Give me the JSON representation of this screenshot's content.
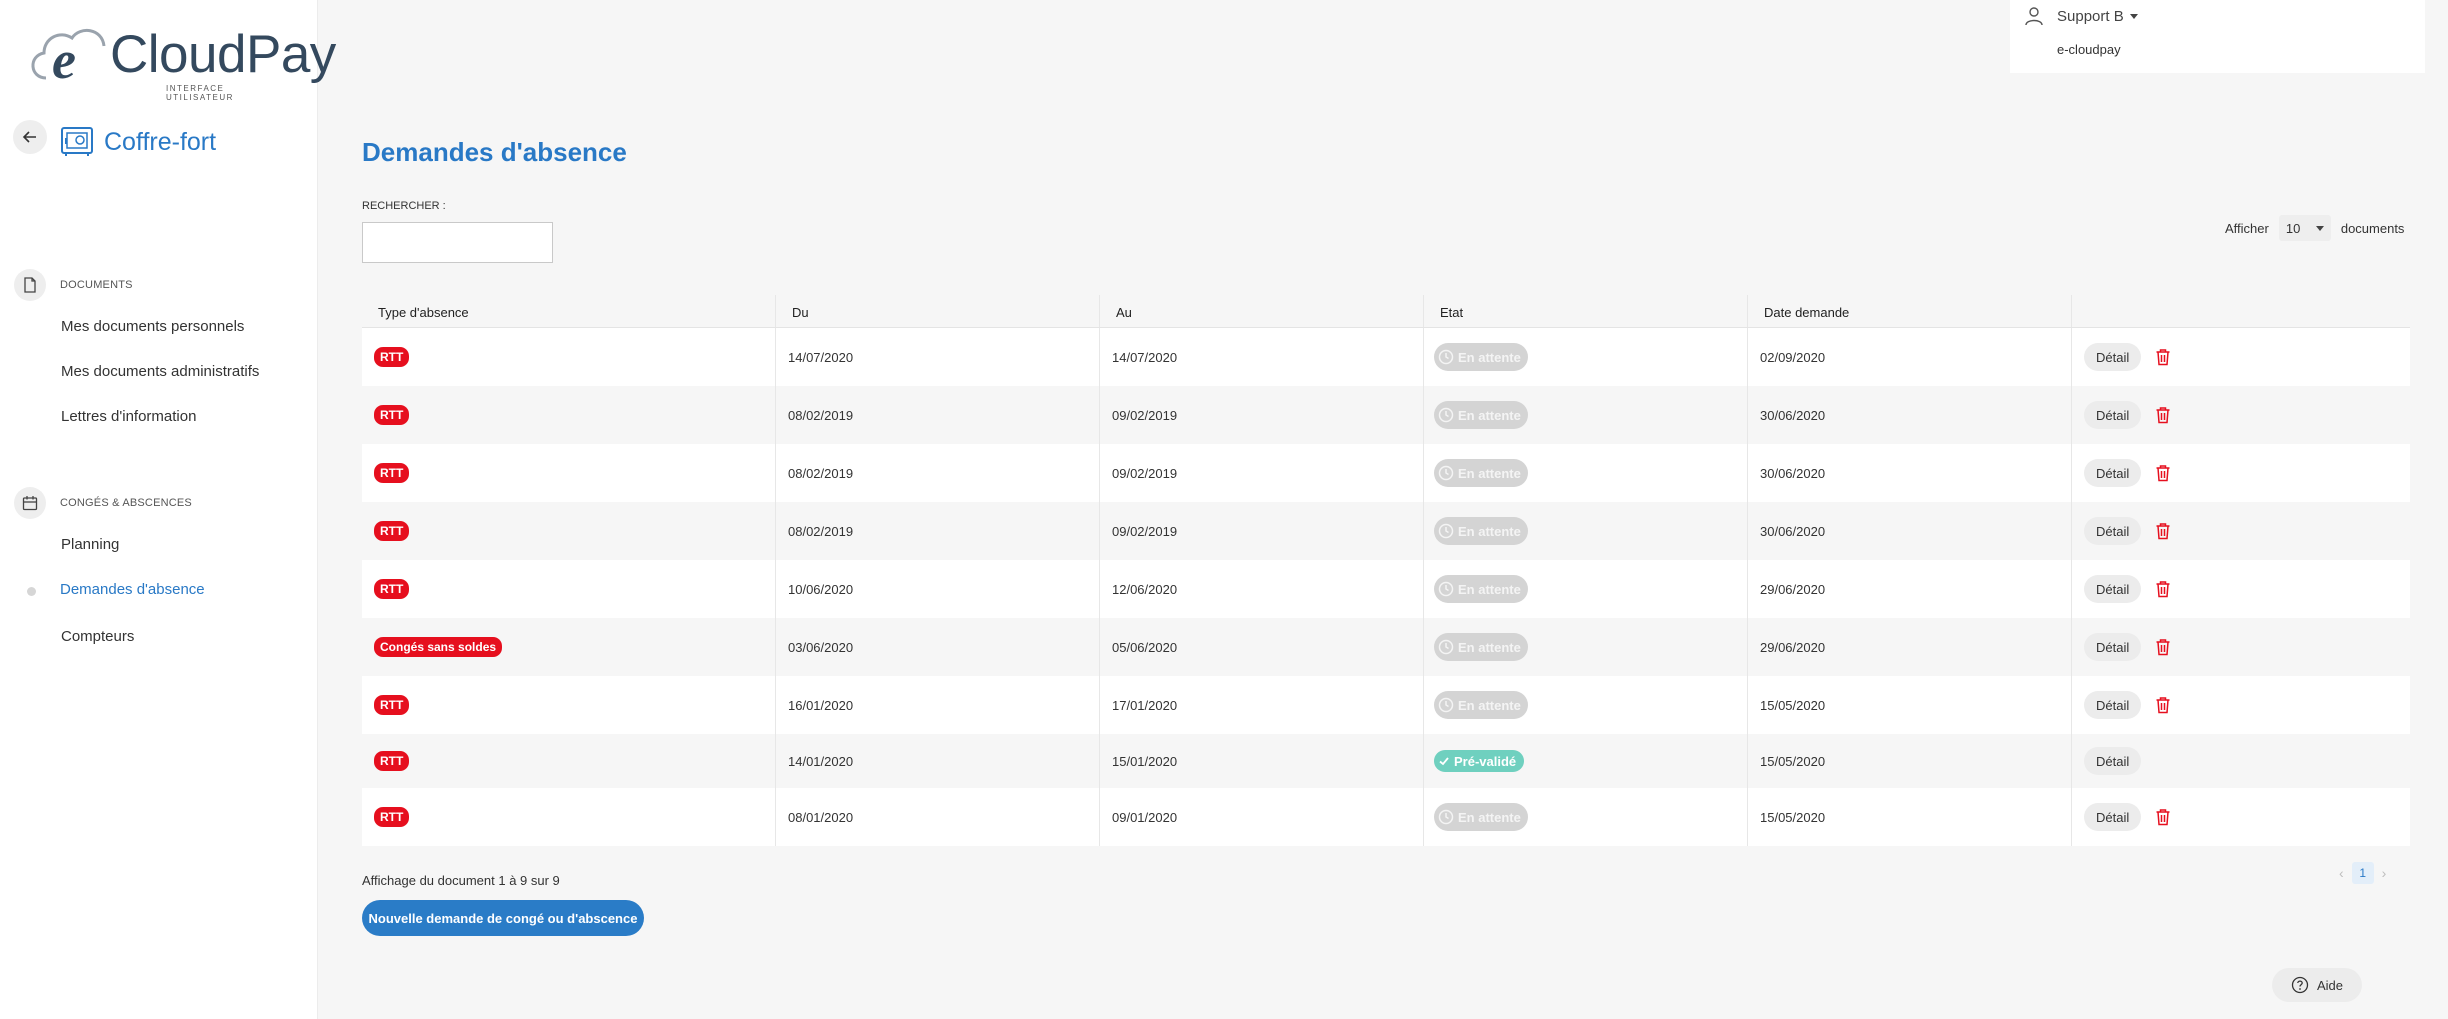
{
  "brand": {
    "name": "CloudPay",
    "tagline": "INTERFACE UTILISATEUR"
  },
  "sidebar": {
    "back_icon": "arrow-left-icon",
    "module_title": "Coffre-fort",
    "sections": [
      {
        "title": "DOCUMENTS",
        "icon": "document-icon",
        "items": [
          "Mes documents personnels",
          "Mes documents administratifs",
          "Lettres d'information"
        ]
      },
      {
        "title": "CONGÉS & ABSCENCES",
        "icon": "calendar-icon",
        "items": [
          "Planning",
          "Demandes d'absence",
          "Compteurs"
        ]
      }
    ],
    "active_item": "Demandes d'absence"
  },
  "user": {
    "name": "Support B",
    "company": "e-cloudpay"
  },
  "main": {
    "title": "Demandes d'absence",
    "search": {
      "label": "RECHERCHER :",
      "value": "",
      "placeholder": ""
    },
    "page_size": {
      "prefix": "Afficher",
      "value": "10",
      "suffix": "documents"
    },
    "columns": [
      "Type d'absence",
      "Du",
      "Au",
      "Etat",
      "Date demande",
      ""
    ],
    "rows": [
      {
        "type": "RTT",
        "du": "14/07/2020",
        "au": "14/07/2020",
        "etat": "En attente",
        "date": "02/09/2020",
        "action": "Détail",
        "deletable": true
      },
      {
        "type": "RTT",
        "du": "08/02/2019",
        "au": "09/02/2019",
        "etat": "En attente",
        "date": "30/06/2020",
        "action": "Détail",
        "deletable": true
      },
      {
        "type": "RTT",
        "du": "08/02/2019",
        "au": "09/02/2019",
        "etat": "En attente",
        "date": "30/06/2020",
        "action": "Détail",
        "deletable": true
      },
      {
        "type": "RTT",
        "du": "08/02/2019",
        "au": "09/02/2019",
        "etat": "En attente",
        "date": "30/06/2020",
        "action": "Détail",
        "deletable": true
      },
      {
        "type": "RTT",
        "du": "10/06/2020",
        "au": "12/06/2020",
        "etat": "En attente",
        "date": "29/06/2020",
        "action": "Détail",
        "deletable": true
      },
      {
        "type": "Congés sans soldes",
        "du": "03/06/2020",
        "au": "05/06/2020",
        "etat": "En attente",
        "date": "29/06/2020",
        "action": "Détail",
        "deletable": true
      },
      {
        "type": "RTT",
        "du": "16/01/2020",
        "au": "17/01/2020",
        "etat": "En attente",
        "date": "15/05/2020",
        "action": "Détail",
        "deletable": true
      },
      {
        "type": "RTT",
        "du": "14/01/2020",
        "au": "15/01/2020",
        "etat": "Pré-validé",
        "date": "15/05/2020",
        "action": "Détail",
        "deletable": false
      },
      {
        "type": "RTT",
        "du": "08/01/2020",
        "au": "09/01/2020",
        "etat": "En attente",
        "date": "15/05/2020",
        "action": "Détail",
        "deletable": true
      }
    ],
    "info": "Affichage du document 1 à 9 sur 9",
    "new_button": "Nouvelle demande de congé ou d'abscence",
    "pagination": {
      "current": "1"
    }
  },
  "help": {
    "label": "Aide"
  },
  "colors": {
    "accent": "#2979c6",
    "danger": "#e60f1e",
    "pending": "#d4d4d4",
    "validated": "#6fd0bf"
  }
}
